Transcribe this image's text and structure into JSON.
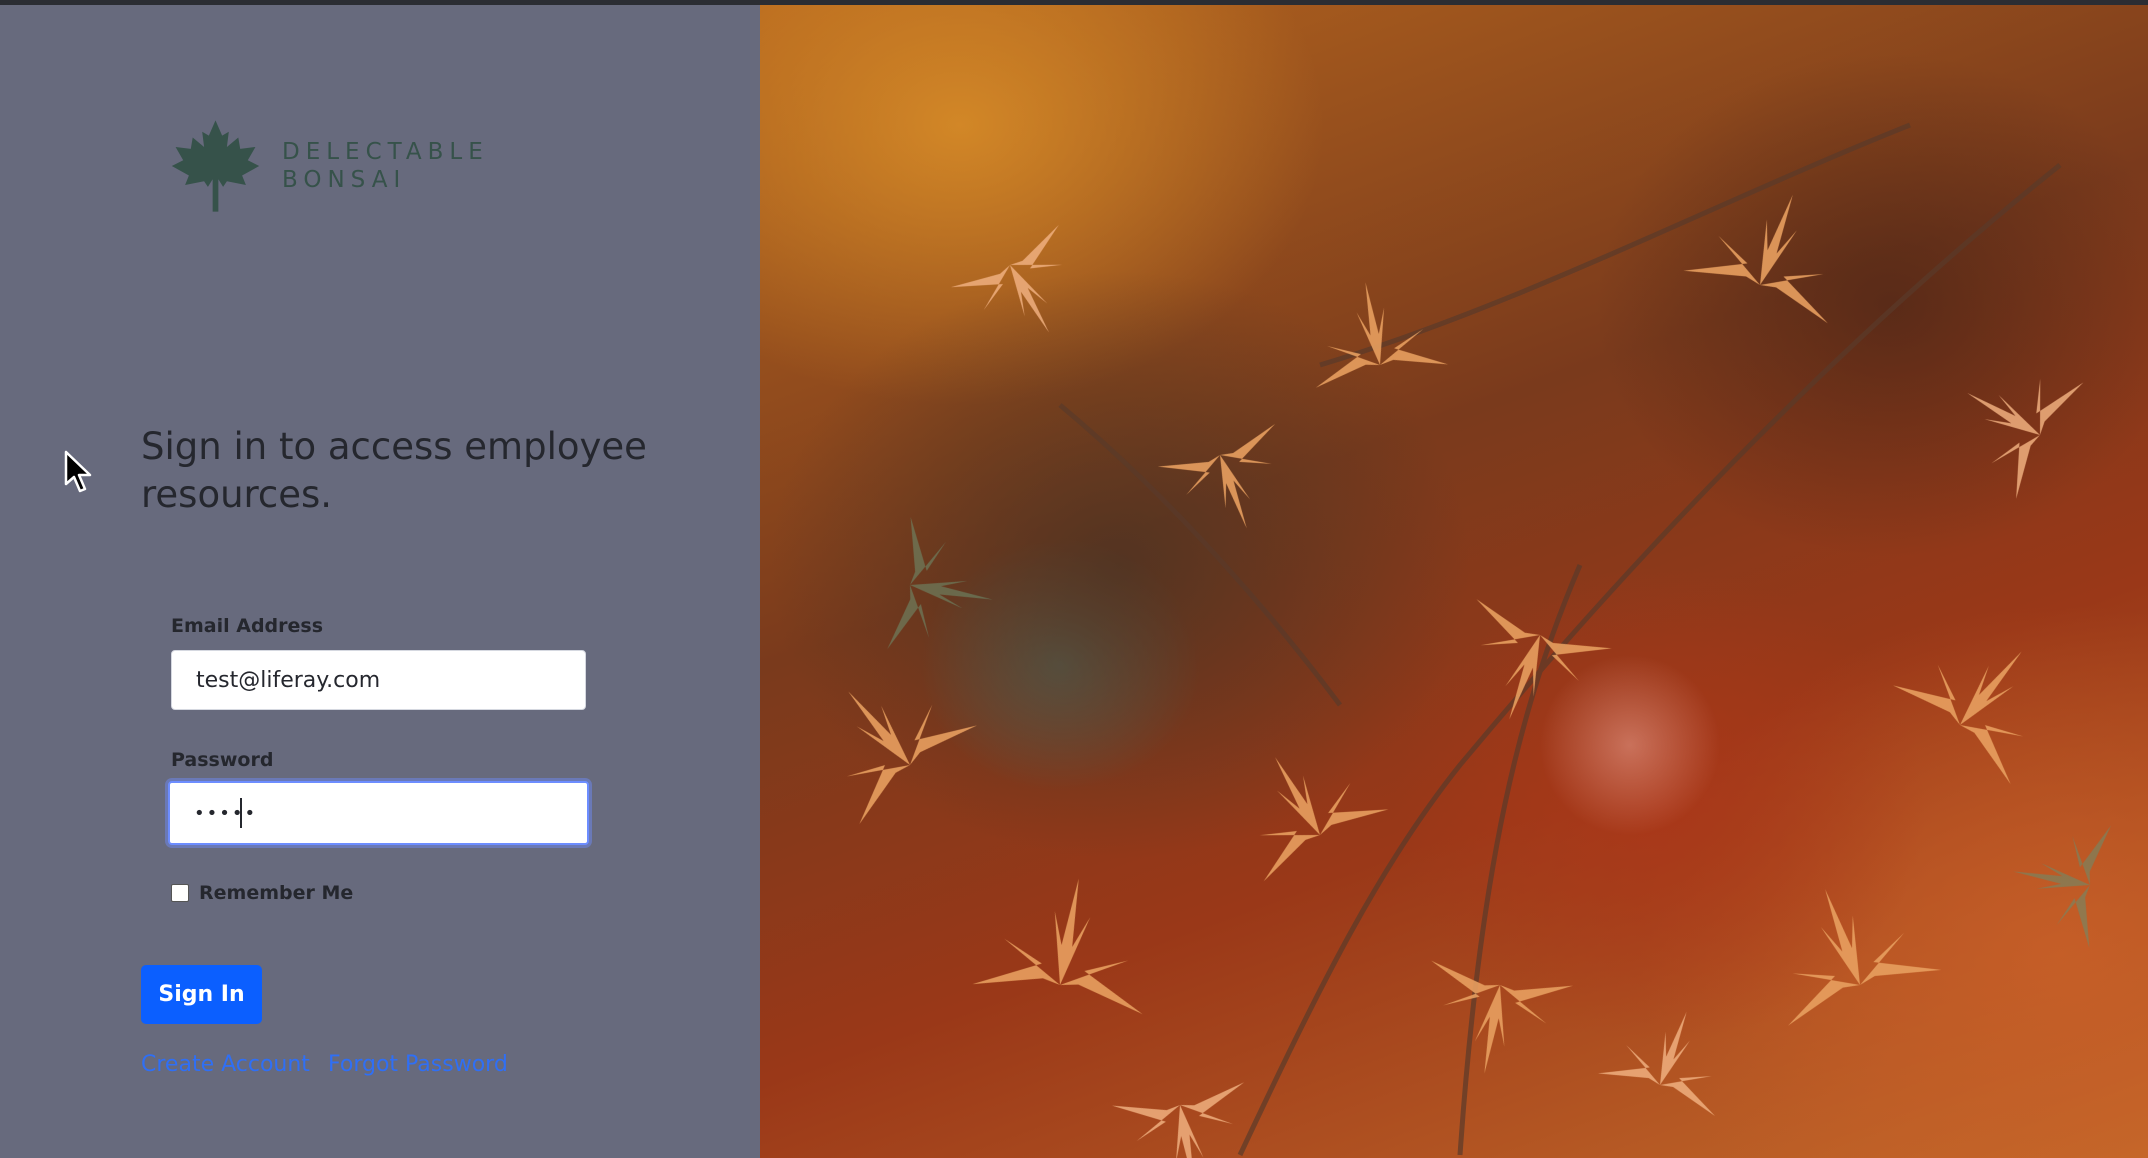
{
  "brand": {
    "name_line1": "DELECTABLE",
    "name_line2": "BONSAI",
    "logo_icon": "maple-leaf-icon",
    "color": "#36524a"
  },
  "login": {
    "heading": "Sign in to access employee resources.",
    "email_label": "Email Address",
    "email_value": "test@liferay.com",
    "password_label": "Password",
    "password_value": "•••••",
    "remember_label": "Remember Me",
    "remember_checked": false,
    "signin_label": "Sign In",
    "create_account_label": "Create Account",
    "forgot_password_label": "Forgot Password"
  },
  "colors": {
    "panel_bg": "#676a7d",
    "primary": "#0b5fff",
    "link": "#2f6ff5"
  },
  "hero_image": {
    "icon": "autumn-maple-leaves-image"
  }
}
